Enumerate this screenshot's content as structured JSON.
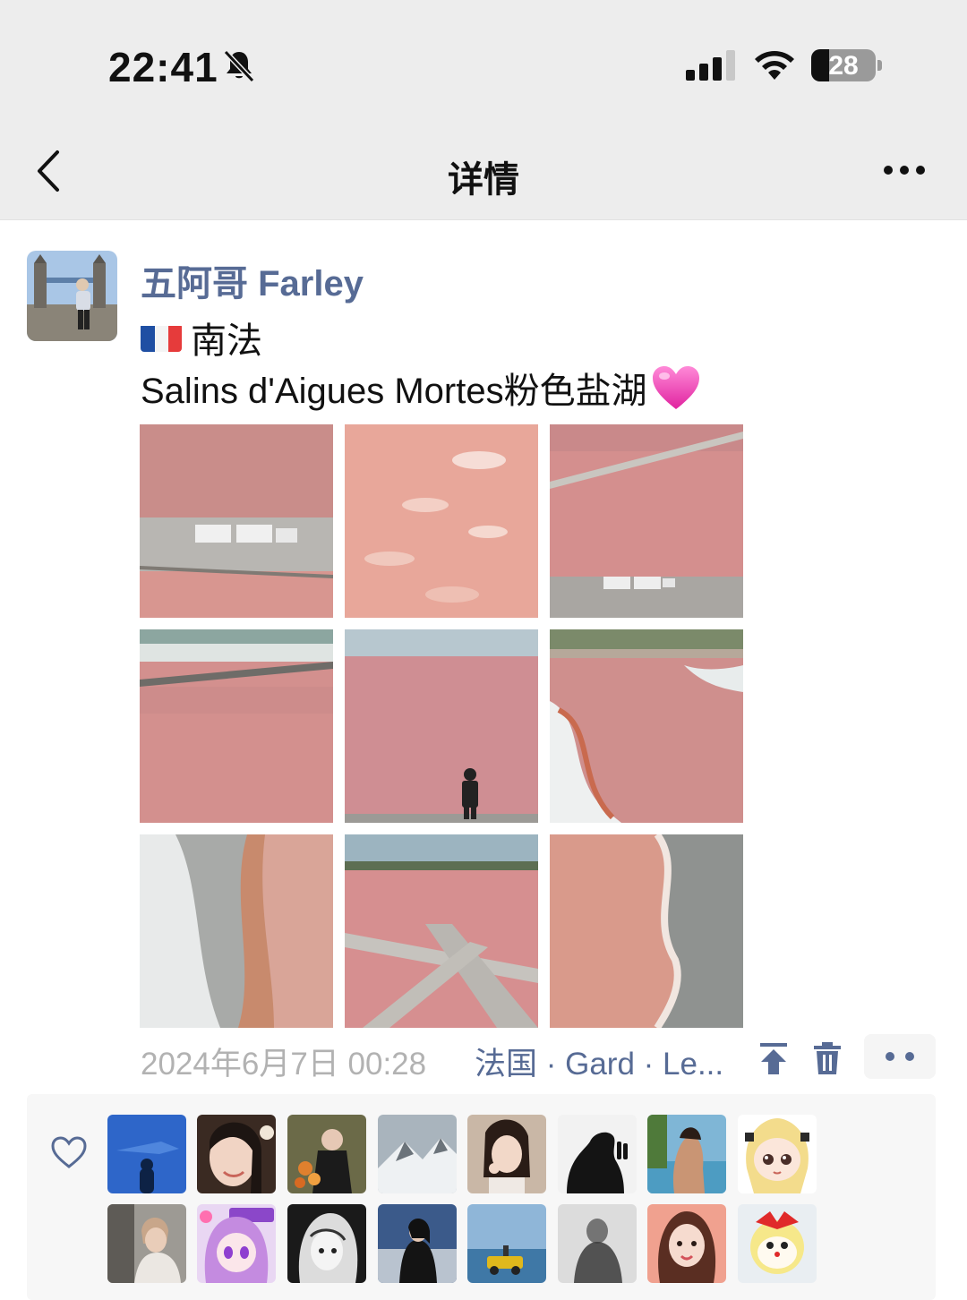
{
  "status_bar": {
    "time": "22:41",
    "battery": "28",
    "battery_level": 0.28,
    "icons": [
      "bell-muted-icon",
      "cellular-signal-icon",
      "wifi-icon",
      "battery-icon"
    ]
  },
  "navbar": {
    "title": "详情",
    "back_icon": "chevron-left-icon",
    "more_icon": "more-dots-icon"
  },
  "post": {
    "author": "五阿哥 Farley",
    "line1_flag": "france-flag-emoji",
    "line1_text": "南法",
    "line2_text": "Salins d'Aigues Mortes粉色盐湖",
    "line2_emoji": "pink-heart-emoji",
    "photos": [
      "pink salt lake with trucks",
      "pink water surface",
      "aerial pink salt pans with road",
      "aerial pink lagoon with dikes",
      "person facing pink lake",
      "aerial pink lagoon shoreline",
      "aerial white salt and pink shore",
      "aerial crossing roads over pink pans",
      "aerial pink edge and grey flats"
    ],
    "date": "2024年6月7日 00:28",
    "location": "法国 · Gard · Le...",
    "action_icons": [
      "pin-top-icon",
      "trash-icon",
      "more-dots-icon"
    ]
  },
  "likes": {
    "icon": "heart-outline-icon",
    "avatars_row1": [
      "shark-aquarium",
      "smiling-girl",
      "girl-with-flowers",
      "snowy-mountains",
      "girl-portrait",
      "silhouette-peace-sign",
      "beach-back",
      "anime-blonde-girl"
    ],
    "avatars_row2": [
      "boy-sitting",
      "anime-heart-girl",
      "manga-girl",
      "girl-in-black",
      "yellow-car-sea",
      "blurred-silhouette",
      "girl-selfie",
      "doraemon-girl"
    ]
  },
  "colors": {
    "link_blue": "#576b95",
    "meta_gray": "#b2b2b2",
    "bar_bg": "#ededed",
    "likes_bg": "#f7f7f7"
  }
}
